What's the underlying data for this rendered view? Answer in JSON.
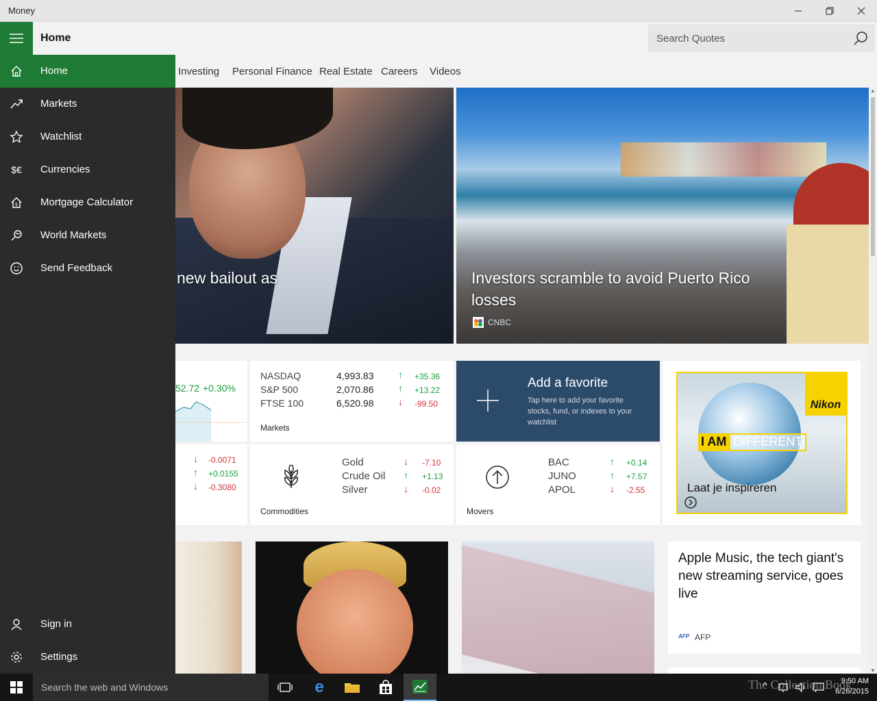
{
  "window": {
    "title": "Money"
  },
  "header": {
    "page_title": "Home",
    "search_placeholder": "Search Quotes"
  },
  "tabs": [
    "Investing",
    "Personal Finance",
    "Real Estate",
    "Careers",
    "Videos"
  ],
  "drawer": {
    "items": [
      {
        "label": "Home",
        "icon": "home-icon",
        "active": true
      },
      {
        "label": "Markets",
        "icon": "trend-icon"
      },
      {
        "label": "Watchlist",
        "icon": "star-icon"
      },
      {
        "label": "Currencies",
        "icon": "currency-icon",
        "glyph": "$€"
      },
      {
        "label": "Mortgage Calculator",
        "icon": "house-dollar-icon"
      },
      {
        "label": "World Markets",
        "icon": "globe-icon"
      },
      {
        "label": "Send Feedback",
        "icon": "smiley-icon"
      }
    ],
    "bottom": [
      {
        "label": "Sign in",
        "icon": "person-icon"
      },
      {
        "label": "Settings",
        "icon": "gear-icon"
      }
    ]
  },
  "hero": {
    "left_caption": "new bailout as",
    "right_caption": "Investors scramble to avoid Puerto Rico losses",
    "right_source": "CNBC"
  },
  "index_card": {
    "value": "52.72",
    "change": "+0.30%"
  },
  "markets": {
    "label": "Markets",
    "rows": [
      {
        "name": "NASDAQ",
        "value": "4,993.83",
        "change": "+35.36",
        "dir": "up"
      },
      {
        "name": "S&P 500",
        "value": "2,070.86",
        "change": "+13.22",
        "dir": "up"
      },
      {
        "name": "FTSE 100",
        "value": "6,520.98",
        "change": "-99.50",
        "dir": "down"
      }
    ]
  },
  "favorite": {
    "title": "Add a favorite",
    "desc": "Tap here to add your favorite stocks, fund, or indexes to your watchlist"
  },
  "currency_changes": [
    {
      "change": "-0.0071",
      "dir": "down"
    },
    {
      "change": "+0.0155",
      "dir": "up"
    },
    {
      "change": "-0.3080",
      "dir": "down"
    }
  ],
  "commodities": {
    "label": "Commodities",
    "rows": [
      {
        "name": "Gold",
        "change": "-7.10",
        "dir": "down"
      },
      {
        "name": "Crude Oil",
        "change": "+1.13",
        "dir": "up"
      },
      {
        "name": "Silver",
        "change": "-0.02",
        "dir": "down"
      }
    ]
  },
  "movers": {
    "label": "Movers",
    "rows": [
      {
        "name": "BAC",
        "change": "+0.14",
        "dir": "up"
      },
      {
        "name": "JUNO",
        "change": "+7.57",
        "dir": "up"
      },
      {
        "name": "APOL",
        "change": "-2.55",
        "dir": "down"
      }
    ]
  },
  "ad": {
    "brand": "Nikon",
    "tag_a": "I AM",
    "tag_b": "DIFFERENT",
    "cta": "Laat je inspireren"
  },
  "news": {
    "headline": "Apple Music, the tech giant's new streaming service, goes live",
    "source": "AFP",
    "source_logo": "AFP"
  },
  "taskbar": {
    "search_placeholder": "Search the web and Windows",
    "time": "9:50 AM",
    "date": "6/26/2015",
    "watermark": "The Collection Book"
  },
  "colors": {
    "accent": "#1e7b35",
    "drawer": "#2b2b2b",
    "up": "#1a9e3e",
    "down": "#d13438",
    "favorite_bg": "#2c4a6a"
  }
}
